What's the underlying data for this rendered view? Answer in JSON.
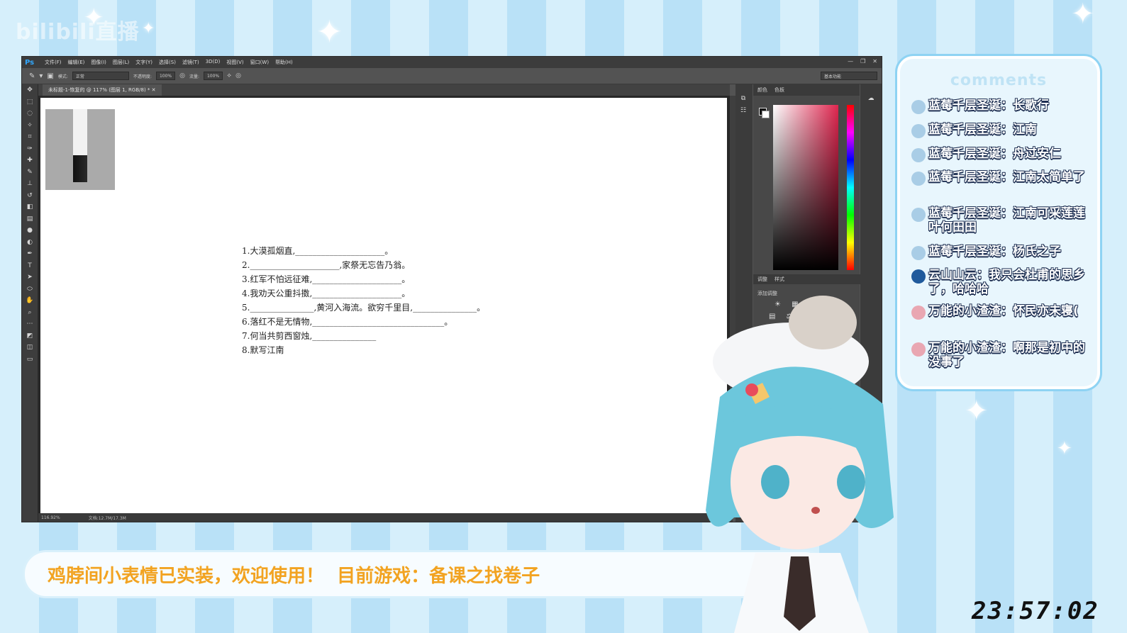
{
  "stream": {
    "watermark": "bilibili直播",
    "ticker_text": "鸡脖间小表情已实装，欢迎使用！  目前游戏：备课之找卷子",
    "clock": "23:57:02",
    "accent_color": "#f2a321"
  },
  "photoshop": {
    "logo": "Ps",
    "menu": [
      "文件(F)",
      "编辑(E)",
      "图像(I)",
      "图层(L)",
      "文字(Y)",
      "选择(S)",
      "滤镜(T)",
      "3D(D)",
      "视图(V)",
      "窗口(W)",
      "帮助(H)"
    ],
    "options": {
      "mode_label": "模式:",
      "mode_value": "正常",
      "opacity_label": "不透明度:",
      "opacity_value": "100%",
      "flow_label": "流量:",
      "flow_value": "100%",
      "workspace": "基本功能"
    },
    "tab_title": "未标题-1-恢复的 @ 117% (图层 1, RGB/8) *",
    "status": {
      "zoom": "116.92%",
      "doc": "文档:12.7M/17.3M"
    },
    "panels": {
      "color_tabs": [
        "颜色",
        "色板"
      ],
      "adjust_tabs": [
        "调整",
        "样式"
      ],
      "adjust_label": "添加调整"
    },
    "tools": [
      "move",
      "marquee",
      "lasso",
      "magic-wand",
      "crop",
      "eyedropper",
      "healing",
      "brush",
      "stamp",
      "history-brush",
      "eraser",
      "gradient",
      "blur",
      "dodge",
      "pen",
      "type",
      "path-select",
      "shape",
      "hand",
      "zoom",
      "more"
    ],
    "document_lines": [
      "1.大漠孤烟直,_____________________。",
      "2._____________________,家祭无忘告乃翁。",
      "3.红军不怕远征难,_____________________。",
      "4.我劝天公重抖擞,_____________________。",
      "5._______________,黄河入海流。欲穷千里目,_______________。",
      "6.落红不是无情物,_______________________________。",
      "7.何当共剪西窗烛,_______________",
      "8.默写江南"
    ]
  },
  "comments": {
    "title": "comments",
    "items": [
      {
        "text": "蓝莓千层圣诞：长歌行",
        "avatar_color": "#a9cde6"
      },
      {
        "text": "蓝莓千层圣诞：江南",
        "avatar_color": "#a9cde6"
      },
      {
        "text": "蓝莓千层圣诞：舟过安仁",
        "avatar_color": "#a9cde6"
      },
      {
        "text": "蓝莓千层圣诞：江南太简单了",
        "avatar_color": "#a9cde6"
      },
      {
        "text": "蓝莓千层圣诞：江南可采莲莲叶何田田",
        "avatar_color": "#a9cde6"
      },
      {
        "text": "蓝莓千层圣诞：杨氏之子",
        "avatar_color": "#a9cde6"
      },
      {
        "text": "云山山云：我只会杜甫的思乡了，哈哈哈",
        "avatar_color": "#1f5a9c"
      },
      {
        "text": "万能的小渣渣：怀民亦未寝(",
        "avatar_color": "#e9a7b2"
      },
      {
        "text": "万能的小渣渣：啊那是初中的 没事了",
        "avatar_color": "#e9a7b2"
      }
    ]
  }
}
